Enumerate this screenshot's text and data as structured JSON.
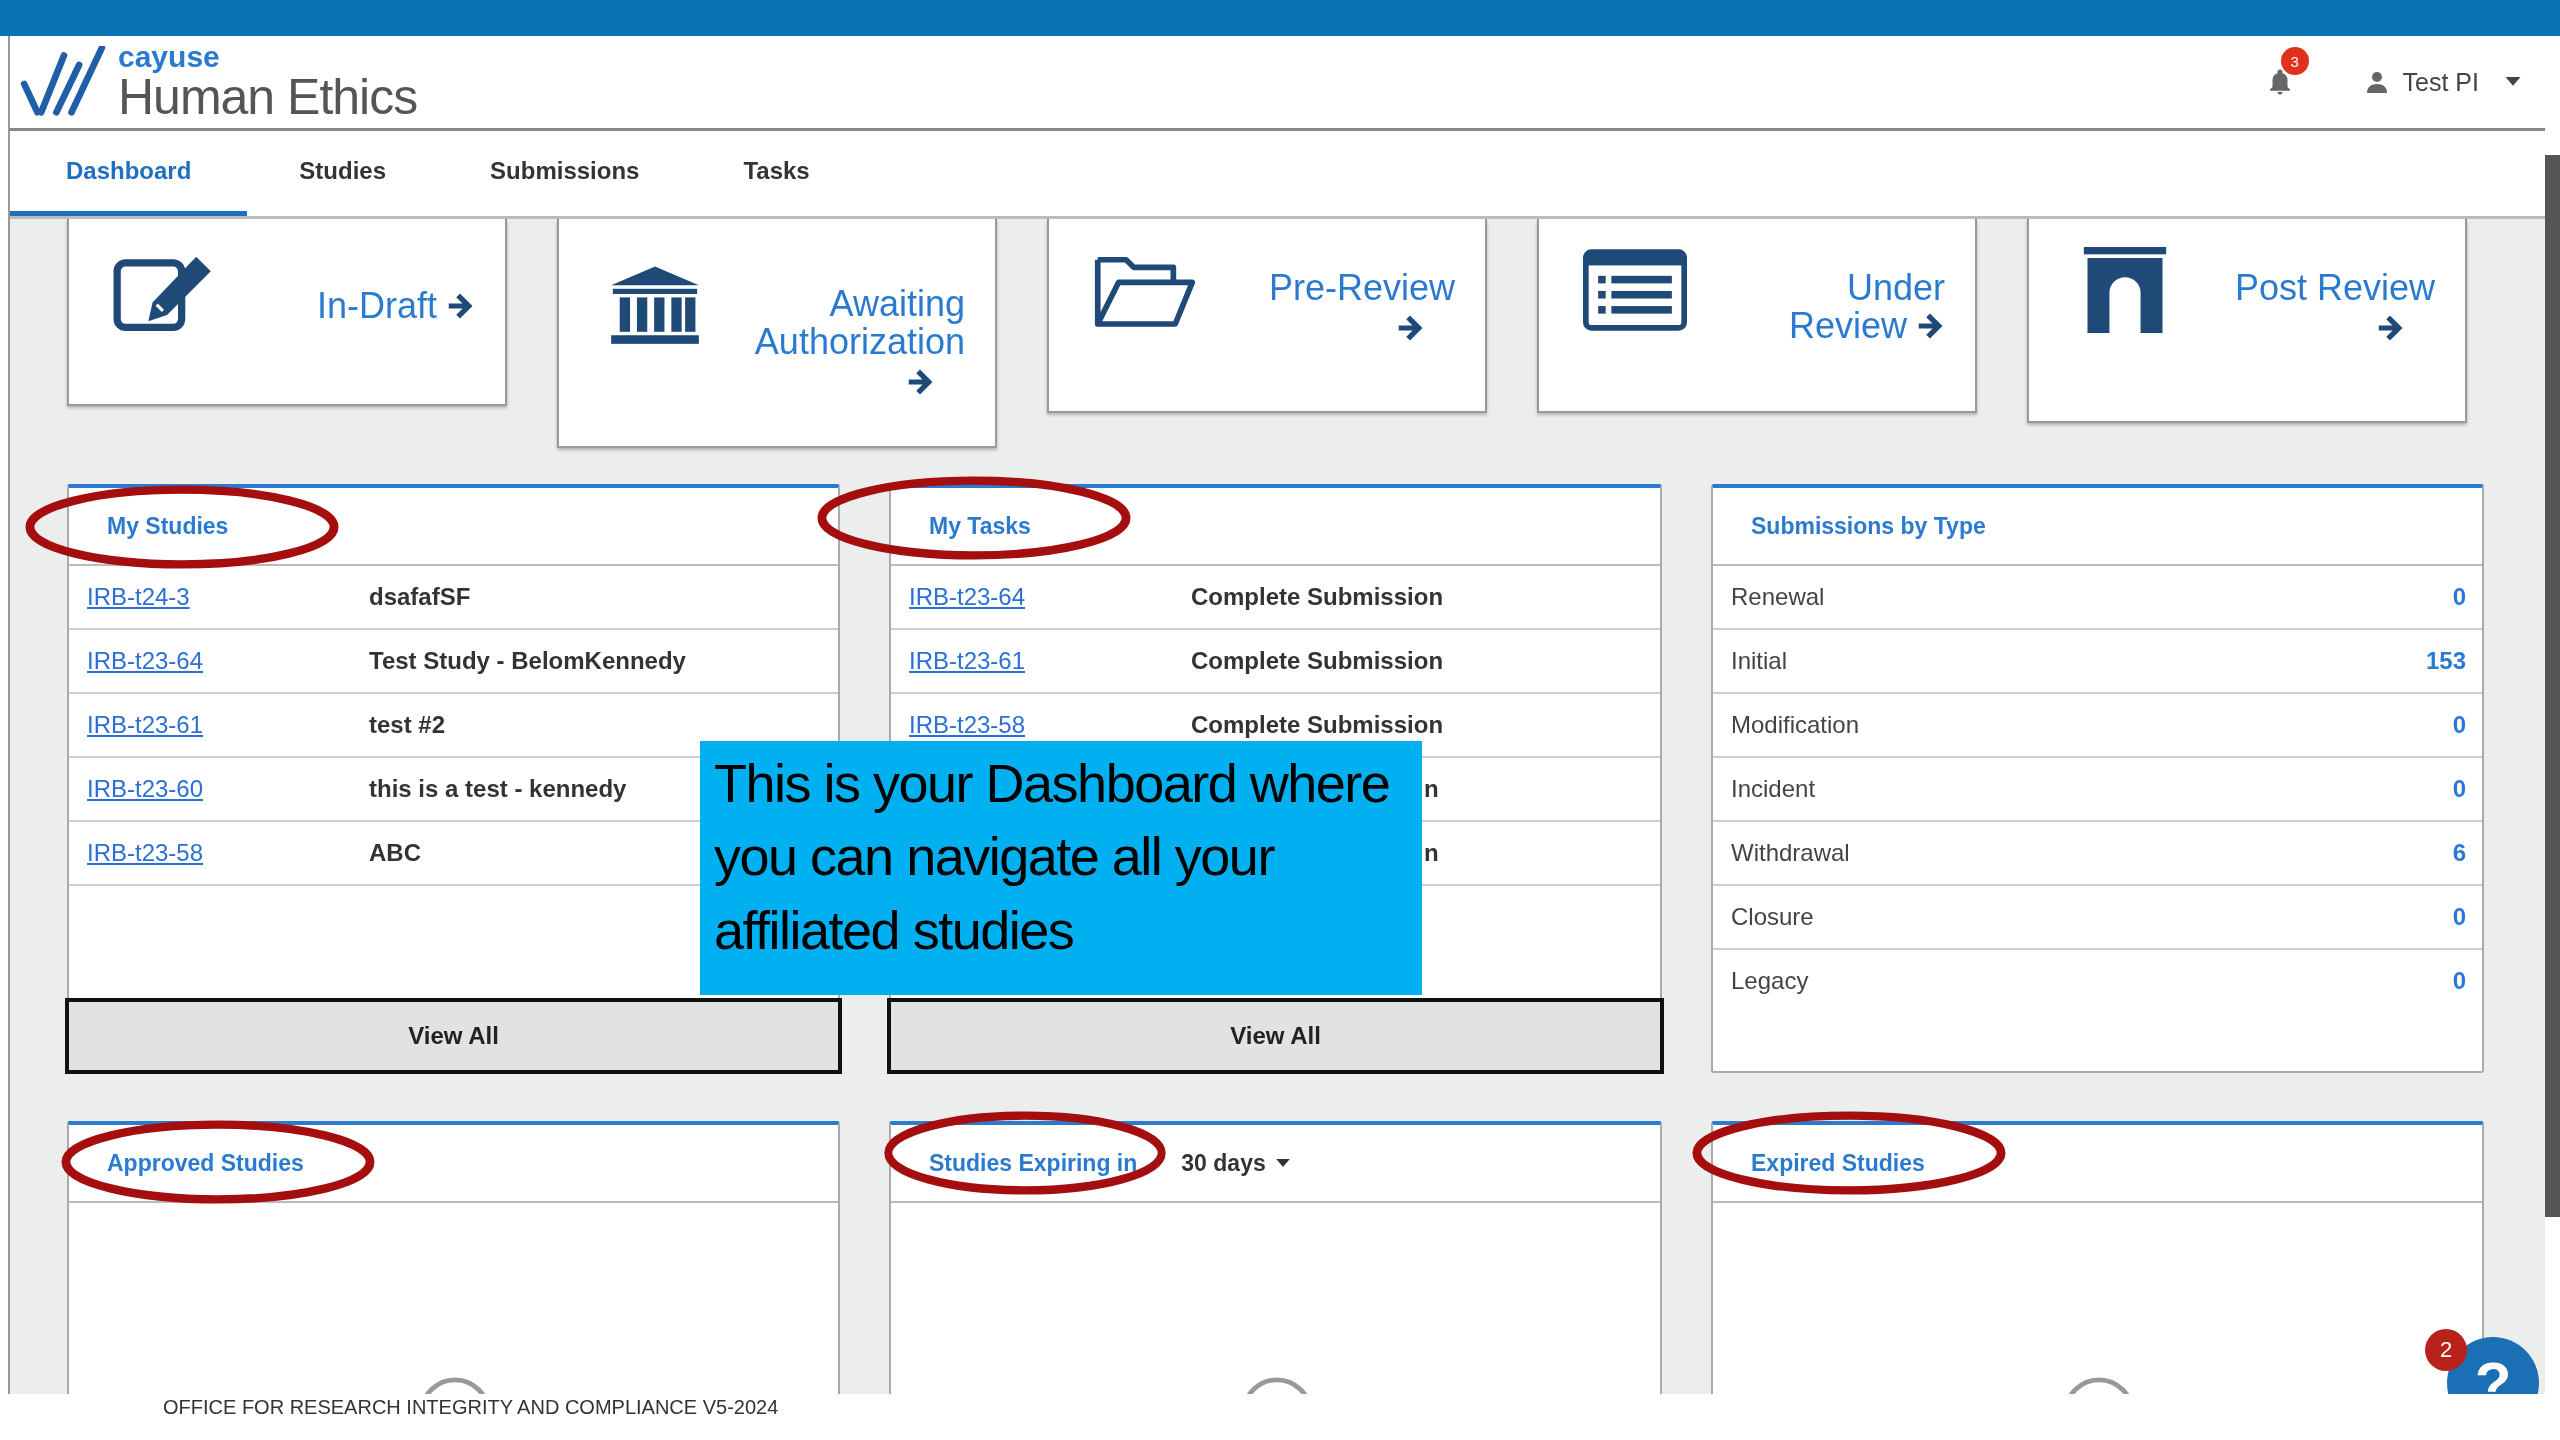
{
  "header": {
    "brand": "cayuse",
    "product": "Human Ethics",
    "notifications": "3",
    "user": "Test PI"
  },
  "tabs": [
    {
      "label": "Dashboard",
      "selected": true
    },
    {
      "label": "Studies",
      "selected": false
    },
    {
      "label": "Submissions",
      "selected": false
    },
    {
      "label": "Tasks",
      "selected": false
    }
  ],
  "tiles": [
    {
      "label": "In-Draft"
    },
    {
      "label": "Awaiting Authorization"
    },
    {
      "label": "Pre-Review"
    },
    {
      "label": "Under Review"
    },
    {
      "label": "Post Review"
    }
  ],
  "my_studies": {
    "title": "My Studies",
    "circled": true,
    "action": "View All",
    "rows": [
      {
        "id": "IRB-t24-3",
        "title": "dsafafSF"
      },
      {
        "id": "IRB-t23-64",
        "title": "Test Study - BelomKennedy"
      },
      {
        "id": "IRB-t23-61",
        "title": "test #2"
      },
      {
        "id": "IRB-t23-60",
        "title": "this is a test - kennedy"
      },
      {
        "id": "IRB-t23-58",
        "title": "ABC"
      }
    ]
  },
  "my_tasks": {
    "title": "My Tasks",
    "circled": true,
    "action": "View All",
    "rows": [
      {
        "id": "IRB-t23-64",
        "action": "Complete Submission"
      },
      {
        "id": "IRB-t23-61",
        "action": "Complete Submission"
      },
      {
        "id": "IRB-t23-58",
        "action": "Complete Submission"
      },
      {
        "tail": "n"
      },
      {
        "tail": "n"
      }
    ]
  },
  "submissions_by_type": {
    "title": "Submissions by Type",
    "rows": [
      {
        "type": "Renewal",
        "count": "0"
      },
      {
        "type": "Initial",
        "count": "153"
      },
      {
        "type": "Modification",
        "count": "0"
      },
      {
        "type": "Incident",
        "count": "0"
      },
      {
        "type": "Withdrawal",
        "count": "6"
      },
      {
        "type": "Closure",
        "count": "0"
      },
      {
        "type": "Legacy",
        "count": "0"
      }
    ]
  },
  "bottom_panels": [
    {
      "title": "Approved Studies",
      "circled": true
    },
    {
      "title": "Studies Expiring in",
      "period": "30 days",
      "circled": true
    },
    {
      "title": "Expired Studies",
      "circled": true
    }
  ],
  "callout": {
    "text": "This is your Dashboard where you can navigate all your affiliated studies"
  },
  "help": {
    "label": "?",
    "badge": "2"
  },
  "footer": {
    "text": "OFFICE FOR RESEARCH INTEGRITY AND COMPLIANCE V5-2024"
  }
}
